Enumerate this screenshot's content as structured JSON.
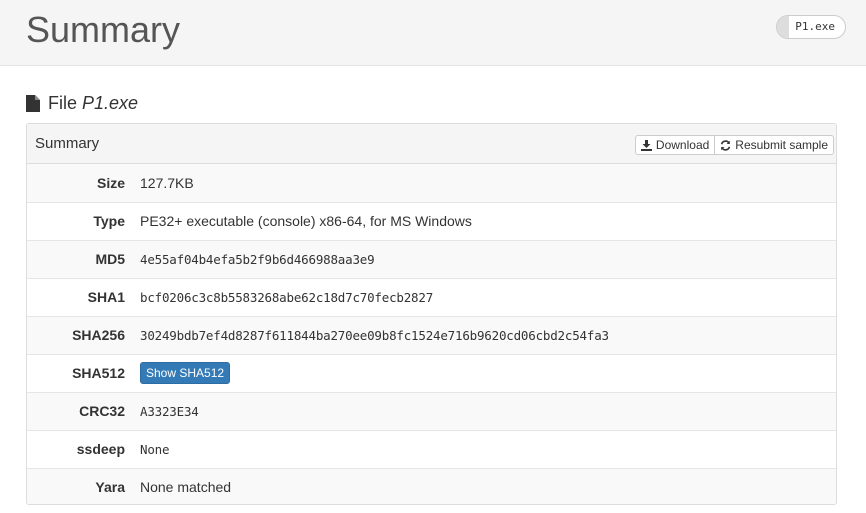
{
  "header": {
    "title": "Summary",
    "file_pill": "P1.exe"
  },
  "file_heading": {
    "label": "File",
    "filename": "P1.exe"
  },
  "panel": {
    "title": "Summary",
    "download_label": "Download",
    "resubmit_label": "Resubmit sample"
  },
  "rows": {
    "size": {
      "label": "Size",
      "value": "127.7KB"
    },
    "type": {
      "label": "Type",
      "value": "PE32+ executable (console) x86-64, for MS Windows"
    },
    "md5": {
      "label": "MD5",
      "value": "4e55af04b4efa5b2f9b6d466988aa3e9"
    },
    "sha1": {
      "label": "SHA1",
      "value": "bcf0206c3c8b5583268abe62c18d7c70fecb2827"
    },
    "sha256": {
      "label": "SHA256",
      "value": "30249bdb7ef4d8287f611844ba270ee09b8fc1524e716b9620cd06cbd2c54fa3"
    },
    "sha512": {
      "label": "SHA512",
      "button": "Show SHA512"
    },
    "crc32": {
      "label": "CRC32",
      "value": "A3323E34"
    },
    "ssdeep": {
      "label": "ssdeep",
      "value": "None"
    },
    "yara": {
      "label": "Yara",
      "value": "None matched"
    }
  }
}
